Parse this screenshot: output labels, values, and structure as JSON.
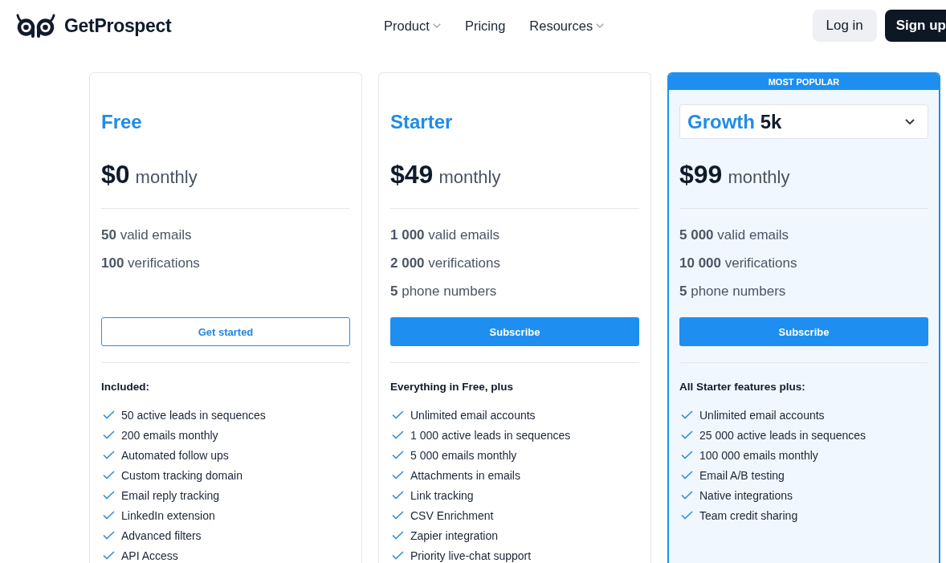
{
  "header": {
    "logo": "GetProspect",
    "nav": [
      {
        "label": "Product",
        "dropdown": true
      },
      {
        "label": "Pricing",
        "dropdown": false
      },
      {
        "label": "Resources",
        "dropdown": true
      }
    ],
    "actions": [
      {
        "label": "Log in",
        "kind": "secondary"
      },
      {
        "label": "Sign up",
        "kind": "primary"
      }
    ]
  },
  "plans": [
    {
      "kind": "plain",
      "name": "Free",
      "highlighted": false,
      "price": "$0",
      "period": "monthly",
      "stats": [
        "**50** valid emails",
        "**100** verifications"
      ],
      "button": {
        "label": "Get started",
        "kind": "outline"
      },
      "features_title": "Included:",
      "features": [
        "50 active leads in sequences",
        "200 emails monthly",
        "Automated follow ups",
        "Custom tracking domain",
        "Email reply tracking",
        "LinkedIn extension",
        "Advanced filters",
        "API Access"
      ]
    },
    {
      "kind": "plain",
      "name": "Starter",
      "highlighted": false,
      "price": "$49",
      "period": "monthly",
      "stats": [
        "**1 000** valid emails",
        "**2 000** verifications",
        "**5** phone numbers"
      ],
      "button": {
        "label": "Subscribe",
        "kind": "filled"
      },
      "features_title": "Everything in Free, plus",
      "features": [
        "Unlimited email accounts",
        "1 000 active leads in sequences",
        "5 000 emails monthly",
        "Attachments in emails",
        "Link tracking",
        "CSV Enrichment",
        "Zapier integration",
        "Priority live-chat support"
      ]
    },
    {
      "kind": "select",
      "badge": "MOST POPULAR",
      "name": "Growth",
      "tier": "5k",
      "highlighted": true,
      "price": "$99",
      "period": "monthly",
      "stats": [
        "**5 000** valid emails",
        "**10 000** verifications",
        "**5** phone numbers"
      ],
      "button": {
        "label": "Subscribe",
        "kind": "filled"
      },
      "features_title": "All Starter features plus:",
      "features": [
        "Unlimited email accounts",
        "25 000 active leads in sequences",
        "100 000 emails monthly",
        "Email A/B testing",
        "Native integrations",
        "Team credit sharing"
      ]
    }
  ]
}
